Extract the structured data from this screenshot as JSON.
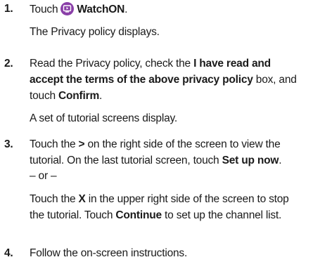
{
  "steps": [
    {
      "number": "1.",
      "touch_word": "Touch",
      "app_name": "WatchON",
      "app_icon": "watchon-app-icon",
      "result": "The Privacy policy displays."
    },
    {
      "number": "2.",
      "line1_a": "Read the Privacy policy, check the ",
      "line1_b": "I have read and",
      "line2_a": "accept the terms of the above privacy policy",
      "line2_b": " box, and",
      "line3_a": "touch ",
      "line3_b": "Confirm",
      "line3_c": ".",
      "result": "A set of tutorial screens display."
    },
    {
      "number": "3.",
      "line1_a": "Touch the ",
      "line1_b": ">",
      "line1_c": " on the right side of the screen to view the",
      "line2_a": "tutorial. On the last tutorial screen, touch ",
      "line2_b": "Set up now",
      "line2_c": ".",
      "or_text": "– or –",
      "alt1_a": "Touch the ",
      "alt1_b": "X",
      "alt1_c": " in the upper right side of the screen to stop",
      "alt2_a": "the tutorial. Touch ",
      "alt2_b": "Continue",
      "alt2_c": " to set up the channel list."
    },
    {
      "number": "4.",
      "text": "Follow the on-screen instructions."
    }
  ]
}
